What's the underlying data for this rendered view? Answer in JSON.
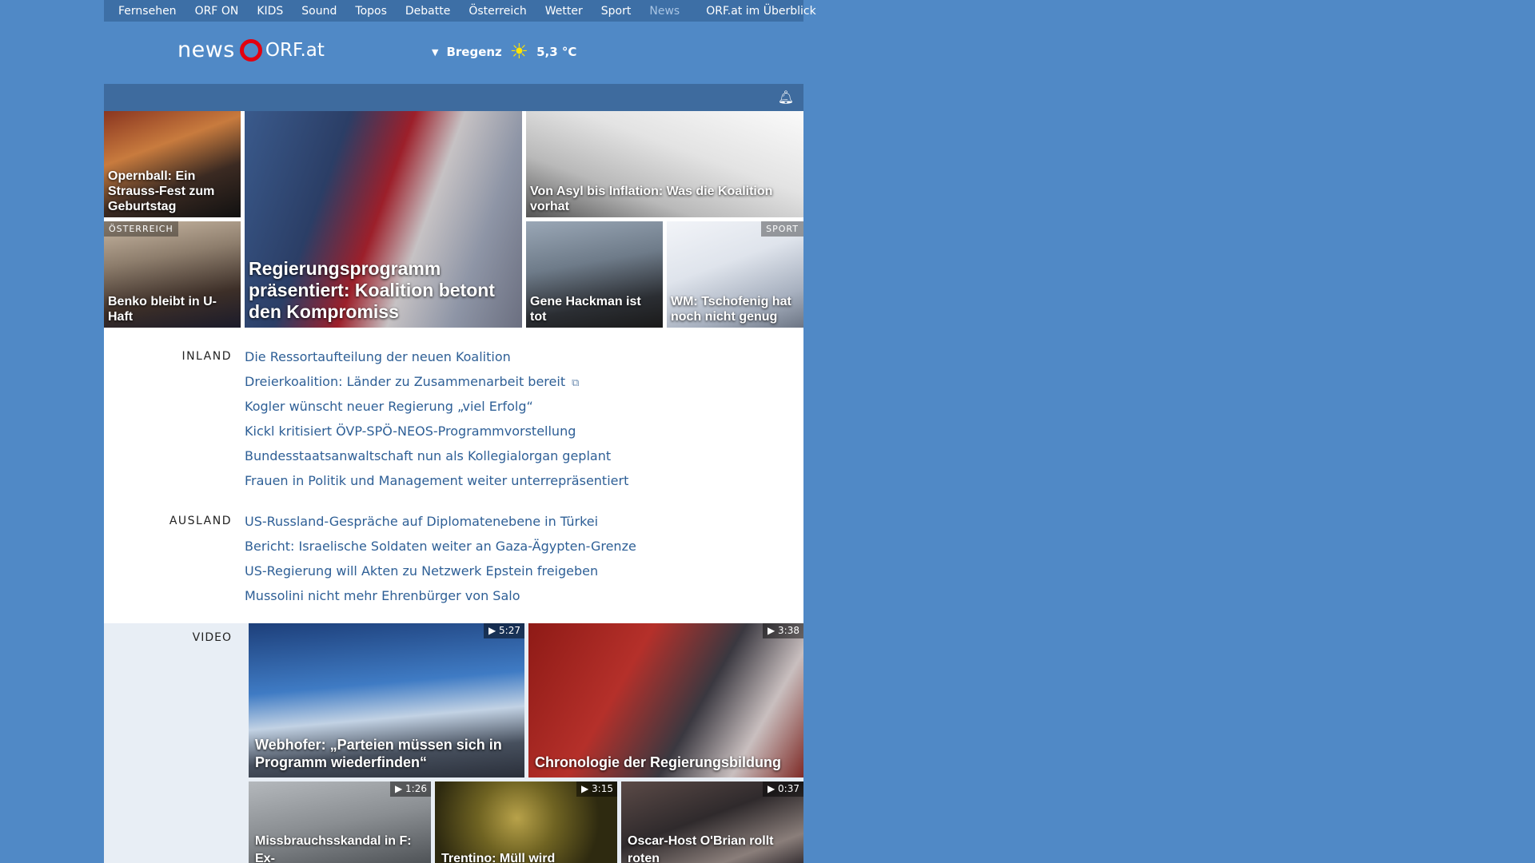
{
  "nav": {
    "items": [
      "Fernsehen",
      "ORF ON",
      "KIDS",
      "Sound",
      "Topos",
      "Debatte",
      "Österreich",
      "Wetter",
      "Sport",
      "News"
    ],
    "overview": "ORF.at im Überblick"
  },
  "logo": {
    "news": "news",
    "orf": "ORF.at"
  },
  "weather": {
    "city": "Bregenz",
    "temp": "5,3 °C"
  },
  "tiles": {
    "opernball": "Opernball: Ein Strauss-Fest zum Geburtstag",
    "main": "Regierungsprogramm präsentiert: Koalition betont den Kompromiss",
    "asyl": "Von Asyl bis Inflation: Was die Koalition vorhat",
    "benko": "Benko bleibt in U-Haft",
    "benko_tag": "ÖSTERREICH",
    "hackman": "Gene Hackman ist tot",
    "wm": "WM: Tschofenig hat noch nicht genug",
    "wm_tag": "SPORT"
  },
  "inland": {
    "label": "INLAND",
    "items": [
      "Die Ressortaufteilung der neuen Koalition",
      "Dreierkoalition: Länder zu Zusammenarbeit bereit",
      "Kogler wünscht neuer Regierung „viel Erfolg“",
      "Kickl kritisiert ÖVP-SPÖ-NEOS-Programmvorstellung",
      "Bundesstaatsanwaltschaft nun als Kollegialorgan geplant",
      "Frauen in Politik und Management weiter unterrepräsentiert"
    ]
  },
  "ausland": {
    "label": "AUSLAND",
    "items": [
      "US-Russland-Gespräche auf Diplomatenebene in Türkei",
      "Bericht: Israelische Soldaten weiter an Gaza-Ägypten-Grenze",
      "US-Regierung will Akten zu Netzwerk Epstein freigeben",
      "Mussolini nicht mehr Ehrenbürger von Salo"
    ]
  },
  "video": {
    "label": "VIDEO",
    "items": [
      {
        "title": "Webhofer: „Parteien müssen sich in Programm wiederfinden“",
        "dur": "5:27"
      },
      {
        "title": "Chronologie der Regierungsbildung",
        "dur": "3:38"
      },
      {
        "title": "Missbrauchsskandal in F: Ex-",
        "dur": "1:26"
      },
      {
        "title": "Trentino: Müll wird",
        "dur": "3:15"
      },
      {
        "title": "Oscar-Host O'Brian rollt roten",
        "dur": "0:37"
      }
    ]
  },
  "colors": {
    "background": "#5089c6",
    "link": "#2e5f96",
    "logo_red": "#e3000f"
  }
}
